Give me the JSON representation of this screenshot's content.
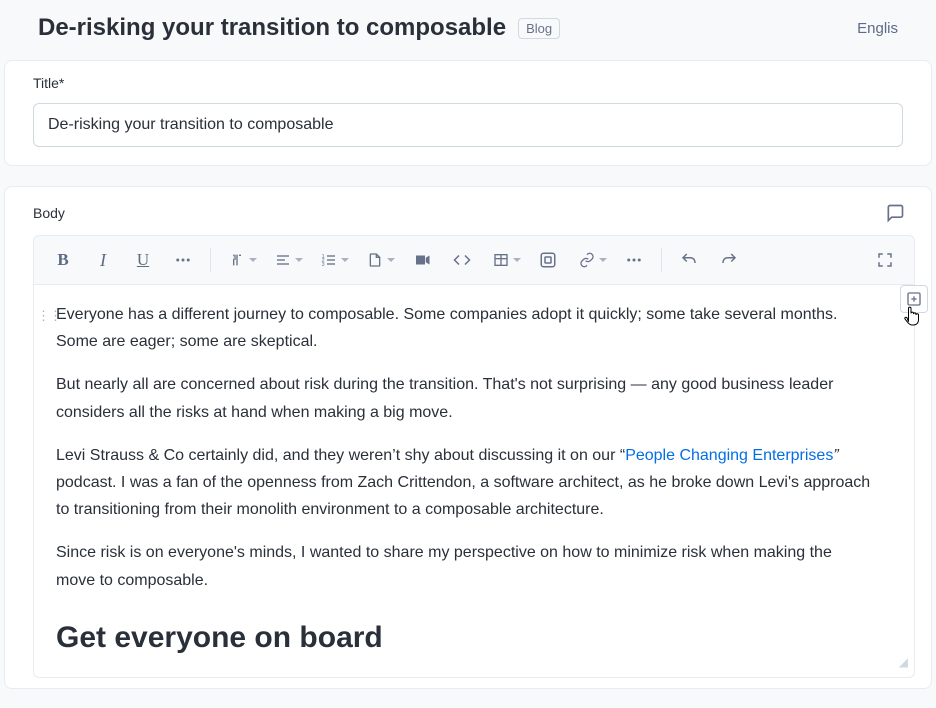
{
  "header": {
    "title": "De-risking your transition to composable",
    "category_tag": "Blog",
    "language": "Englis"
  },
  "title_field": {
    "label": "Title*",
    "value": "De-risking your transition to composable"
  },
  "body_field": {
    "label": "Body",
    "icons": {
      "bold": "B",
      "italic": "I",
      "underline": "U"
    },
    "content": {
      "p1": "Everyone has a different journey to composable. Some companies adopt it quickly; some take several months. Some are eager; some are skeptical.",
      "p2": "But nearly all are concerned about risk during the transition. That's not surprising — any good business leader considers all the risks at hand when making a big move.",
      "p3a": "Levi Strauss & Co certainly did, and they weren’t shy about discussing it on our “",
      "p3link": "People Changing Enterprises",
      "p3b": "”",
      "p3c": " podcast. I was a fan of the openness from Zach Crittendon, a software architect, as he broke down Levi's approach to transitioning from their monolith environment to a composable architecture.",
      "p4": "Since risk is on everyone's minds, I wanted to share my perspective on how to minimize risk when making the move to composable.",
      "h2": "Get everyone on board"
    }
  }
}
